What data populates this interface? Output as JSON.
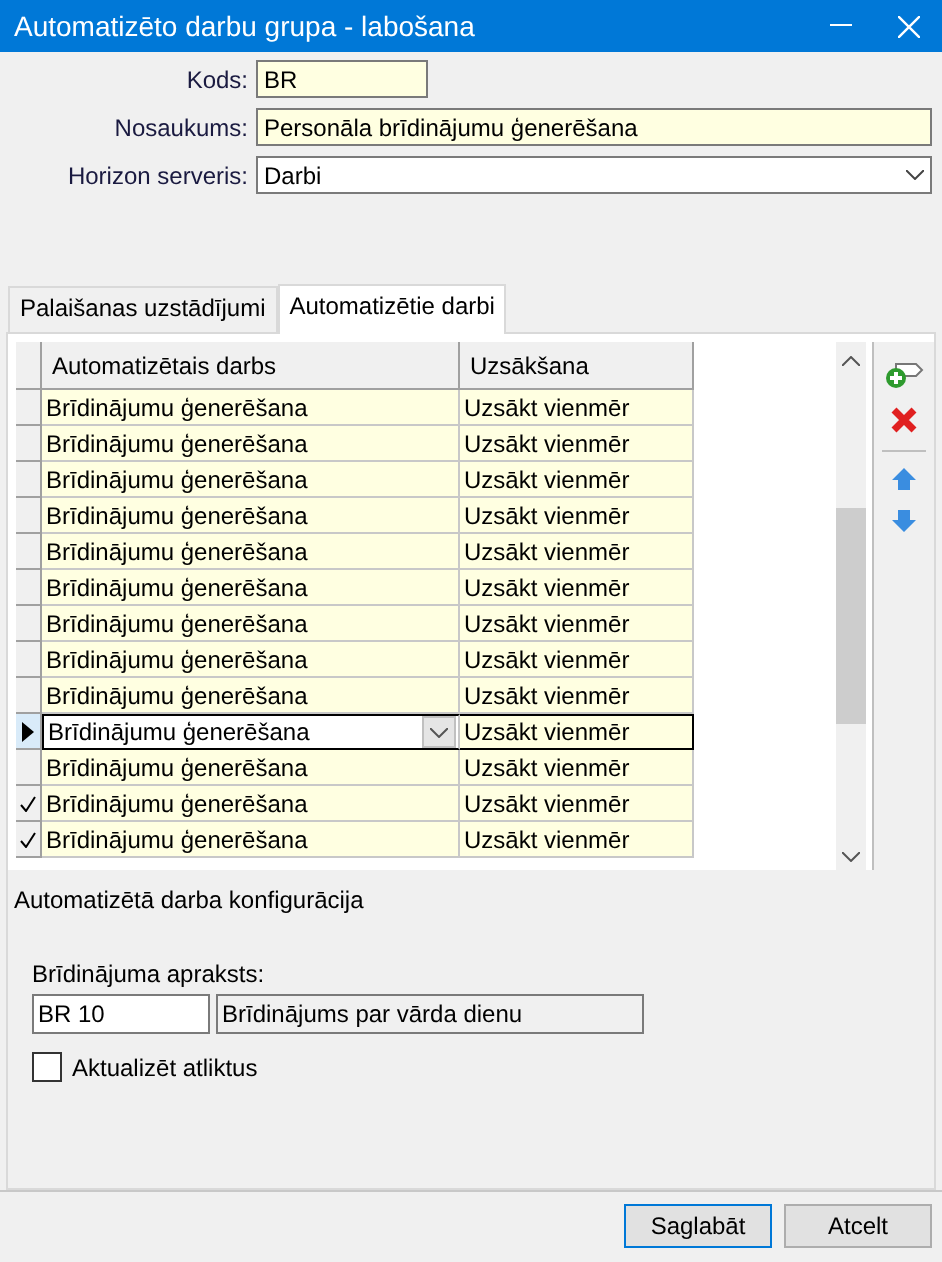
{
  "window": {
    "title": "Automatizēto darbu grupa - labošana"
  },
  "form": {
    "kods": {
      "label": "Kods:",
      "value": "BR"
    },
    "nosaukums": {
      "label": "Nosaukums:",
      "value": "Personāla brīdinājumu ģenerēšana"
    },
    "server": {
      "label": "Horizon serveris:",
      "value": "Darbi"
    }
  },
  "tabs": [
    {
      "label": "Palaišanas uzstādījumi",
      "selected": false
    },
    {
      "label": "Automatizētie darbi",
      "selected": true
    }
  ],
  "table": {
    "columns": [
      "Automatizētais darbs",
      "Uzsākšana"
    ],
    "rows": [
      {
        "job": "Brīdinājumu ģenerēšana",
        "start": "Uzsākt vienmēr",
        "selected": false,
        "checked": false
      },
      {
        "job": "Brīdinājumu ģenerēšana",
        "start": "Uzsākt vienmēr",
        "selected": false,
        "checked": false
      },
      {
        "job": "Brīdinājumu ģenerēšana",
        "start": "Uzsākt vienmēr",
        "selected": false,
        "checked": false
      },
      {
        "job": "Brīdinājumu ģenerēšana",
        "start": "Uzsākt vienmēr",
        "selected": false,
        "checked": false
      },
      {
        "job": "Brīdinājumu ģenerēšana",
        "start": "Uzsākt vienmēr",
        "selected": false,
        "checked": false
      },
      {
        "job": "Brīdinājumu ģenerēšana",
        "start": "Uzsākt vienmēr",
        "selected": false,
        "checked": false
      },
      {
        "job": "Brīdinājumu ģenerēšana",
        "start": "Uzsākt vienmēr",
        "selected": false,
        "checked": false
      },
      {
        "job": "Brīdinājumu ģenerēšana",
        "start": "Uzsākt vienmēr",
        "selected": false,
        "checked": false
      },
      {
        "job": "Brīdinājumu ģenerēšana",
        "start": "Uzsākt vienmēr",
        "selected": false,
        "checked": false
      },
      {
        "job": "Brīdinājumu ģenerēšana",
        "start": "Uzsākt vienmēr",
        "selected": true,
        "checked": false
      },
      {
        "job": "Brīdinājumu ģenerēšana",
        "start": "Uzsākt vienmēr",
        "selected": false,
        "checked": false
      },
      {
        "job": "Brīdinājumu ģenerēšana",
        "start": "Uzsākt vienmēr",
        "selected": false,
        "checked": true
      },
      {
        "job": "Brīdinājumu ģenerēšana",
        "start": "Uzsākt vienmēr",
        "selected": false,
        "checked": true
      }
    ]
  },
  "config": {
    "title": "Automatizētā darba konfigurācija",
    "label": "Brīdinājuma apraksts:",
    "code": "BR 10",
    "description": "Brīdinājums par vārda dienu",
    "checkbox": {
      "label": "Aktualizēt atliktus",
      "checked": false
    }
  },
  "buttons": [
    "Saglabāt",
    "Atcelt"
  ]
}
